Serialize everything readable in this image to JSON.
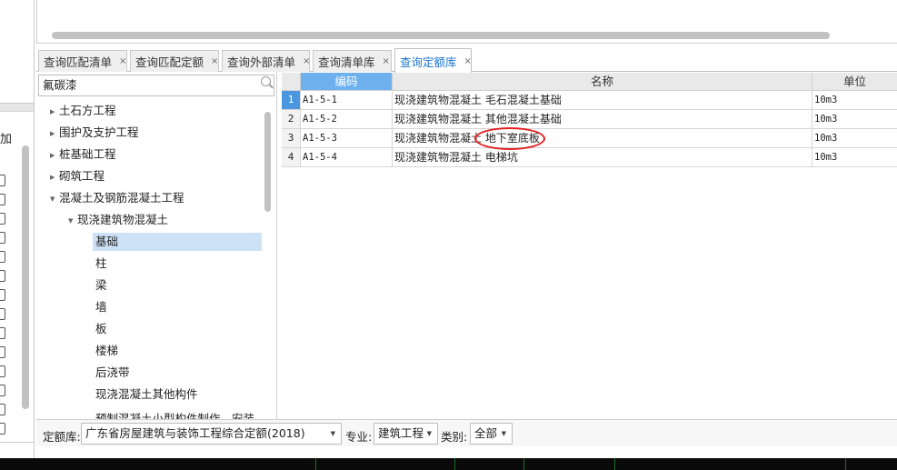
{
  "left_strip": {
    "header_fragment": "加"
  },
  "tabs": [
    {
      "label": "查询匹配清单",
      "close": "×",
      "active": false
    },
    {
      "label": "查询匹配定额",
      "close": "×",
      "active": false
    },
    {
      "label": "查询外部清单",
      "close": "×",
      "active": false
    },
    {
      "label": "查询清单库",
      "close": "×",
      "active": false
    },
    {
      "label": "查询定额库",
      "close": "×",
      "active": true
    }
  ],
  "search": {
    "value": "氟碳漆"
  },
  "tree": [
    {
      "label": "土石方工程",
      "level": 0,
      "expanded": false
    },
    {
      "label": "围护及支护工程",
      "level": 0,
      "expanded": false
    },
    {
      "label": "桩基础工程",
      "level": 0,
      "expanded": false
    },
    {
      "label": "砌筑工程",
      "level": 0,
      "expanded": false
    },
    {
      "label": "混凝土及钢筋混凝土工程",
      "level": 0,
      "expanded": true
    },
    {
      "label": "现浇建筑物混凝土",
      "level": 1,
      "expanded": true
    },
    {
      "label": "基础",
      "level": 2,
      "selected": true
    },
    {
      "label": "柱",
      "level": 2
    },
    {
      "label": "梁",
      "level": 2
    },
    {
      "label": "墙",
      "level": 2
    },
    {
      "label": "板",
      "level": 2
    },
    {
      "label": "楼梯",
      "level": 2
    },
    {
      "label": "后浇带",
      "level": 2
    },
    {
      "label": "现浇混凝土其他构件",
      "level": 2
    },
    {
      "label": "预制混凝土小型构件制作、安装",
      "level": 2
    }
  ],
  "grid": {
    "columns": {
      "code": "编码",
      "name": "名称",
      "unit": "单位"
    },
    "rows": [
      {
        "index": "1",
        "code": "A1-5-1",
        "name": "现浇建筑物混凝土 毛石混凝土基础",
        "unit": "10m3"
      },
      {
        "index": "2",
        "code": "A1-5-2",
        "name": "现浇建筑物混凝土 其他混凝土基础",
        "unit": "10m3"
      },
      {
        "index": "3",
        "code": "A1-5-3",
        "name": "现浇建筑物混凝土 地下室底板",
        "unit": "10m3"
      },
      {
        "index": "4",
        "code": "A1-5-4",
        "name": "现浇建筑物混凝土 电梯坑",
        "unit": "10m3"
      }
    ]
  },
  "filters": {
    "quota_lib_label": "定额库:",
    "quota_lib_value": "广东省房屋建筑与装饰工程综合定额(2018)",
    "major_label": "专业:",
    "major_value": "建筑工程",
    "category_label": "类别:",
    "category_value": "全部"
  },
  "colors": {
    "active_tab_text": "#1a73c9",
    "header_highlight": "#6fb1ef",
    "selected_tree": "#cde2f7",
    "annotation_ring": "#e02020"
  }
}
